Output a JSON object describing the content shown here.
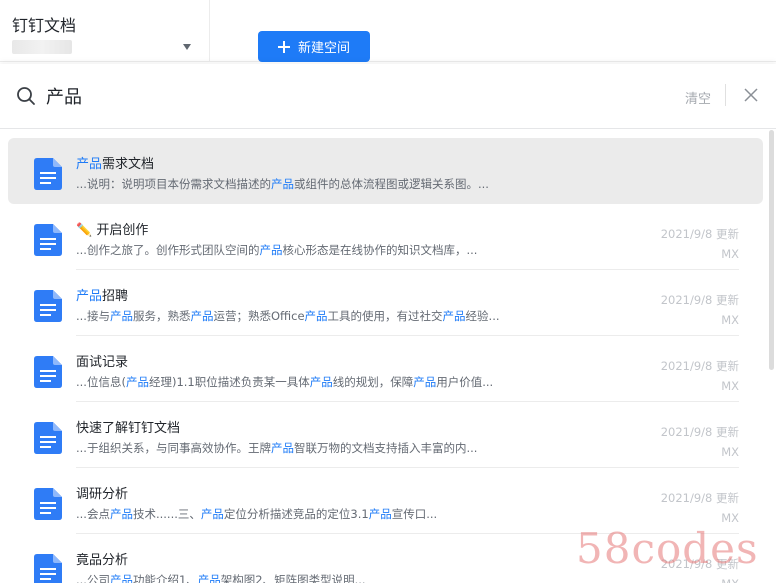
{
  "app": {
    "title": "钉钉文档",
    "new_space_label": "新建空间"
  },
  "search": {
    "query": "产品",
    "clear_label": "清空"
  },
  "results": [
    {
      "title": [
        {
          "t": "产品",
          "h": true
        },
        {
          "t": "需求文档",
          "h": false
        }
      ],
      "snippet": [
        {
          "t": "...说明：说明项目本份需求文档描述的",
          "h": false
        },
        {
          "t": "产品",
          "h": true
        },
        {
          "t": "或组件的总体流程图或逻辑关系图。...",
          "h": false
        }
      ],
      "date": "",
      "author": "",
      "active": true
    },
    {
      "title": [
        {
          "t": "✏️ 开启创作",
          "h": false
        }
      ],
      "snippet": [
        {
          "t": "...创作之旅了。创作形式团队空间的",
          "h": false
        },
        {
          "t": "产品",
          "h": true
        },
        {
          "t": "核心形态是在线协作的知识文档库，...",
          "h": false
        }
      ],
      "date": "2021/9/8 更新",
      "author": "MX",
      "active": false
    },
    {
      "title": [
        {
          "t": "产品",
          "h": true
        },
        {
          "t": "招聘",
          "h": false
        }
      ],
      "snippet": [
        {
          "t": "...接与",
          "h": false
        },
        {
          "t": "产品",
          "h": true
        },
        {
          "t": "服务，熟悉",
          "h": false
        },
        {
          "t": "产品",
          "h": true
        },
        {
          "t": "运营；熟悉Office",
          "h": false
        },
        {
          "t": "产品",
          "h": true
        },
        {
          "t": "工具的使用，有过社交",
          "h": false
        },
        {
          "t": "产品",
          "h": true
        },
        {
          "t": "经验...",
          "h": false
        }
      ],
      "date": "2021/9/8 更新",
      "author": "MX",
      "active": false
    },
    {
      "title": [
        {
          "t": "面试记录",
          "h": false
        }
      ],
      "snippet": [
        {
          "t": "...位信息(",
          "h": false
        },
        {
          "t": "产品",
          "h": true
        },
        {
          "t": "经理)1.1职位描述负责某一具体",
          "h": false
        },
        {
          "t": "产品",
          "h": true
        },
        {
          "t": "线的规划，保障",
          "h": false
        },
        {
          "t": "产品",
          "h": true
        },
        {
          "t": "用户价值...",
          "h": false
        }
      ],
      "date": "2021/9/8 更新",
      "author": "MX",
      "active": false
    },
    {
      "title": [
        {
          "t": "快速了解钉钉文档",
          "h": false
        }
      ],
      "snippet": [
        {
          "t": "...于组织关系，与同事高效协作。王牌",
          "h": false
        },
        {
          "t": "产品",
          "h": true
        },
        {
          "t": "智联万物的文档支持插入丰富的内...",
          "h": false
        }
      ],
      "date": "2021/9/8 更新",
      "author": "MX",
      "active": false
    },
    {
      "title": [
        {
          "t": "调研分析",
          "h": false
        }
      ],
      "snippet": [
        {
          "t": "...会点",
          "h": false
        },
        {
          "t": "产品",
          "h": true
        },
        {
          "t": "技术......三、",
          "h": false
        },
        {
          "t": "产品",
          "h": true
        },
        {
          "t": "定位分析描述竞品的定位3.1",
          "h": false
        },
        {
          "t": "产品",
          "h": true
        },
        {
          "t": "宣传口...",
          "h": false
        }
      ],
      "date": "2021/9/8 更新",
      "author": "MX",
      "active": false
    },
    {
      "title": [
        {
          "t": "竟品分析",
          "h": false
        }
      ],
      "snippet": [
        {
          "t": "...公司",
          "h": false
        },
        {
          "t": "产品",
          "h": true
        },
        {
          "t": "功能介绍1、",
          "h": false
        },
        {
          "t": "产品",
          "h": true
        },
        {
          "t": "架构图2、矩阵图类型说明...",
          "h": false
        }
      ],
      "date": "2021/9/8 更新",
      "author": "MX",
      "active": false
    }
  ],
  "watermark": "58codes",
  "colors": {
    "accent": "#1e7bf7",
    "highlight": "#1e7bf7",
    "doc_icon": "#2f7cf6",
    "active_row": "#ebebeb"
  }
}
